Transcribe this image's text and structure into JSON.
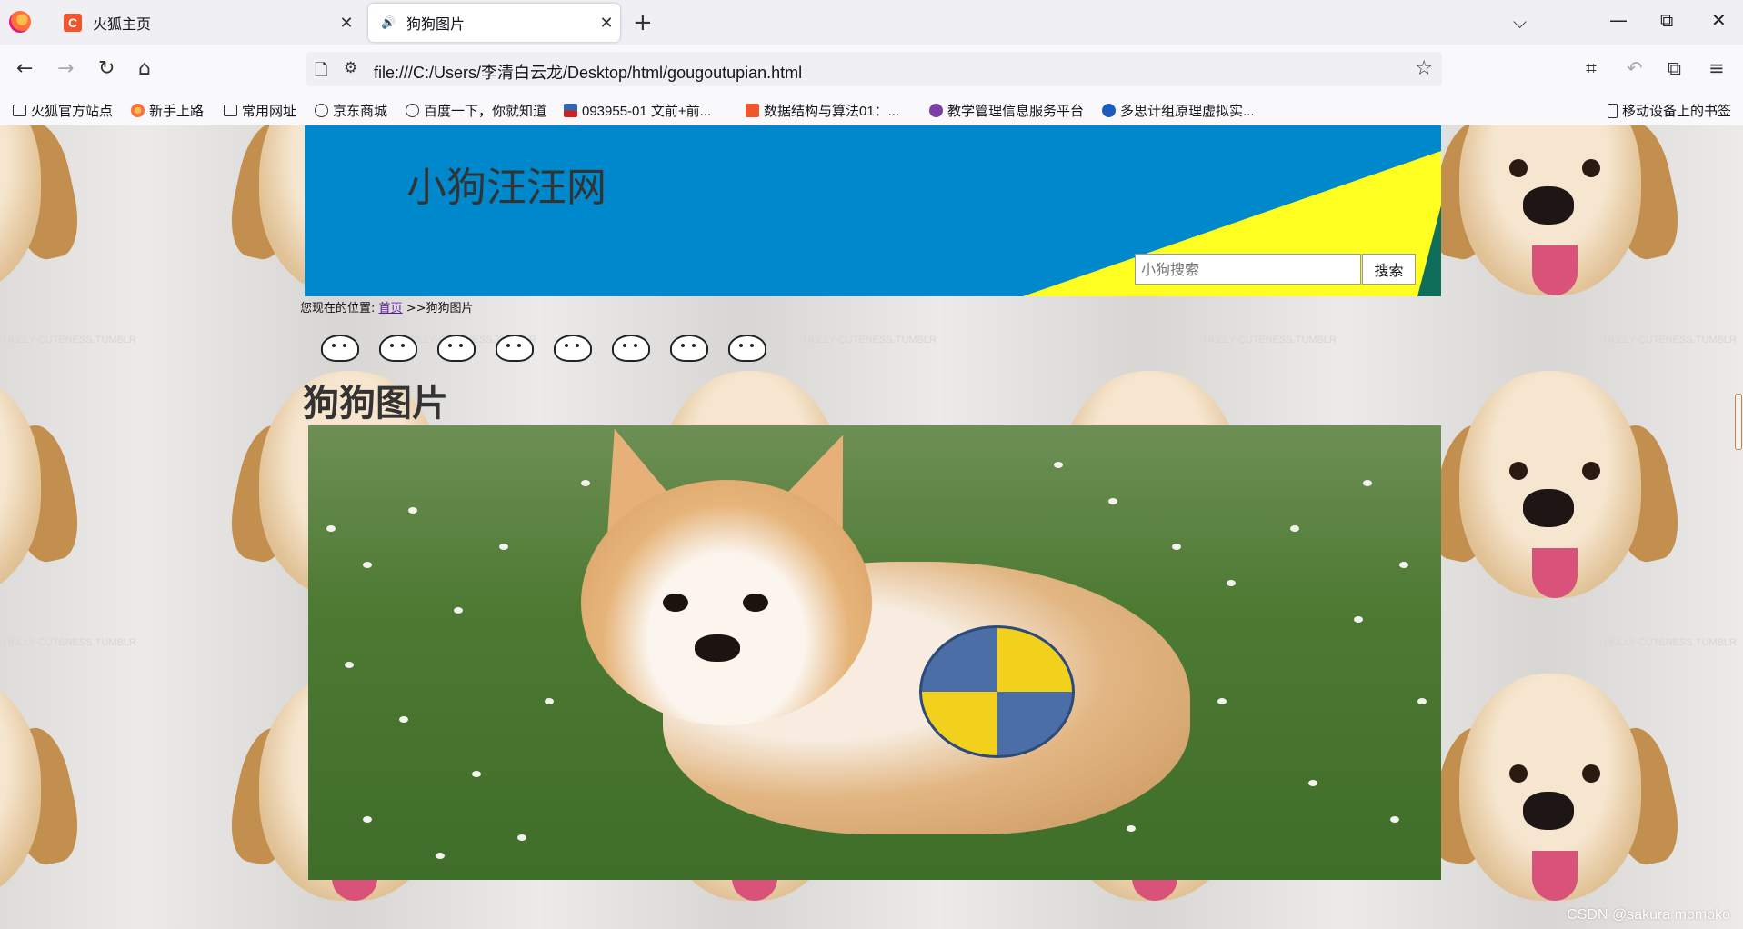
{
  "browser": {
    "tabs": [
      {
        "label": "火狐主页",
        "active": false
      },
      {
        "label": "狗狗图片",
        "active": true
      }
    ],
    "url": "file:///C:/Users/李清白云龙/Desktop/html/gougoutupian.html",
    "bookmarks": [
      {
        "label": "火狐官方站点",
        "icon": "folder-icon"
      },
      {
        "label": "新手上路",
        "icon": "firefox-icon"
      },
      {
        "label": "常用网址",
        "icon": "folder-icon"
      },
      {
        "label": "京东商城",
        "icon": "globe-icon"
      },
      {
        "label": "百度一下，你就知道",
        "icon": "globe-icon"
      },
      {
        "label": "093955-01 文前+前...",
        "icon": "flag-icon"
      },
      {
        "label": "数据结构与算法01：...",
        "icon": "csdn-icon"
      },
      {
        "label": "教学管理信息服务平台",
        "icon": "purple-circle-icon"
      },
      {
        "label": "多思计组原理虚拟实...",
        "icon": "blue-bird-icon"
      }
    ],
    "mobile_bookmarks": "移动设备上的书签"
  },
  "page": {
    "logo": "小狗汪汪网",
    "search": {
      "placeholder": "小狗搜索",
      "button": "搜索"
    },
    "breadcrumb": {
      "prefix": "您现在的位置:",
      "home": "首页",
      "current": ">>狗狗图片"
    },
    "heading": "狗狗图片",
    "background_watermark": "HOLLY-CUTENESS.TUMBLR",
    "dog_icon_count": 8
  },
  "watermark": "CSDN @sakura   momoko",
  "colors": {
    "header_bg": "#0088cc",
    "header_accent": "#ffff22",
    "header_corner": "#0f6e5a",
    "logo_text": "#333333",
    "link_visited": "#5a1aa0"
  }
}
